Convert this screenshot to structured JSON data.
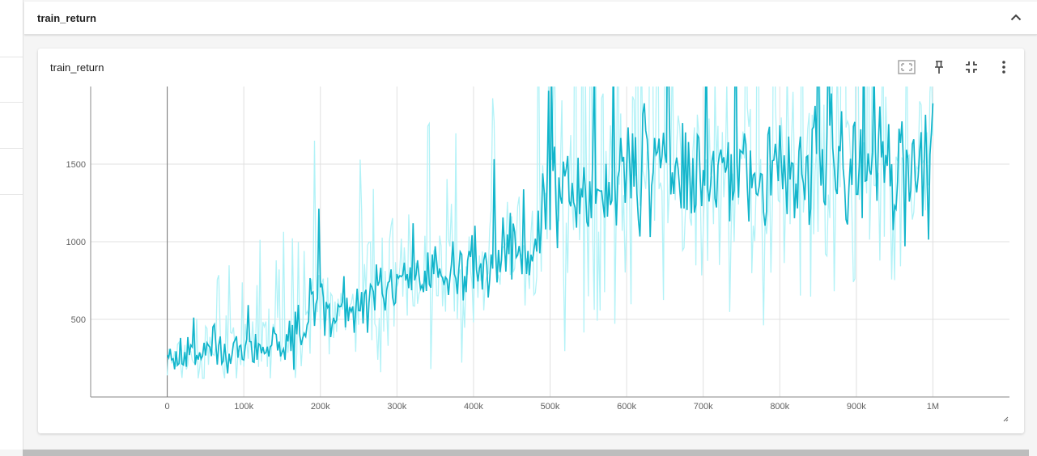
{
  "section": {
    "title": "train_return",
    "collapse_icon": "chevron-up-icon"
  },
  "card": {
    "title": "train_return",
    "tools": [
      {
        "name": "fit-domain-button",
        "icon": "fit-to-data-icon"
      },
      {
        "name": "pin-button",
        "icon": "pin-icon"
      },
      {
        "name": "fullscreen-button",
        "icon": "exit-fullscreen-icon"
      },
      {
        "name": "more-button",
        "icon": "more-vert-icon"
      }
    ]
  },
  "colors": {
    "raw": "#b2f2f7",
    "smoothed": "#12b5cb",
    "grid": "#e0e0e0",
    "tick_text": "#616161"
  },
  "chart_data": {
    "type": "line",
    "title": "train_return",
    "xlim": [
      -100000,
      1100000
    ],
    "ylim": [
      0,
      2000
    ],
    "xticks": [
      0,
      100000,
      200000,
      300000,
      400000,
      500000,
      600000,
      700000,
      800000,
      900000,
      1000000
    ],
    "xtick_labels": [
      "0",
      "100k",
      "200k",
      "300k",
      "400k",
      "500k",
      "600k",
      "700k",
      "800k",
      "900k",
      "1M"
    ],
    "yticks": [
      500,
      1000,
      1500
    ],
    "ytick_labels": [
      "500",
      "1000",
      "1500"
    ],
    "grid": true,
    "series": [
      {
        "role": "smoothed",
        "x": [
          0,
          25000,
          50000,
          75000,
          100000,
          125000,
          150000,
          175000,
          195000,
          215000,
          240000,
          265000,
          285000,
          300000,
          325000,
          350000,
          375000,
          400000,
          425000,
          450000,
          475000,
          490000,
          525000,
          550000,
          575000,
          600000,
          625000,
          650000,
          675000,
          700000,
          725000,
          750000,
          775000,
          800000,
          825000,
          850000,
          875000,
          900000,
          925000,
          950000,
          975000,
          1000000
        ],
        "y": [
          240,
          250,
          270,
          275,
          290,
          330,
          350,
          380,
          700,
          480,
          540,
          660,
          720,
          740,
          680,
          780,
          820,
          820,
          900,
          900,
          880,
          1250,
          1330,
          1310,
          1360,
          1470,
          1470,
          1510,
          1410,
          1440,
          1460,
          1490,
          1460,
          1400,
          1430,
          1460,
          1470,
          1450,
          1470,
          1430,
          1470,
          1500
        ]
      },
      {
        "role": "raw",
        "x": [
          0,
          25000,
          50000,
          75000,
          100000,
          125000,
          150000,
          175000,
          195000,
          215000,
          240000,
          265000,
          285000,
          300000,
          325000,
          350000,
          375000,
          400000,
          425000,
          450000,
          475000,
          490000,
          525000,
          550000,
          575000,
          600000,
          625000,
          650000,
          675000,
          700000,
          725000,
          750000,
          775000,
          800000,
          825000,
          850000,
          875000,
          900000,
          925000,
          950000,
          975000,
          1000000
        ],
        "y": [
          240,
          250,
          270,
          275,
          290,
          330,
          350,
          380,
          700,
          480,
          540,
          660,
          720,
          740,
          680,
          780,
          820,
          820,
          900,
          900,
          880,
          1250,
          1330,
          1310,
          1360,
          1470,
          1470,
          1510,
          1410,
          1440,
          1460,
          1490,
          1460,
          1400,
          1430,
          1460,
          1470,
          1450,
          1470,
          1430,
          1470,
          1500
        ]
      }
    ]
  }
}
